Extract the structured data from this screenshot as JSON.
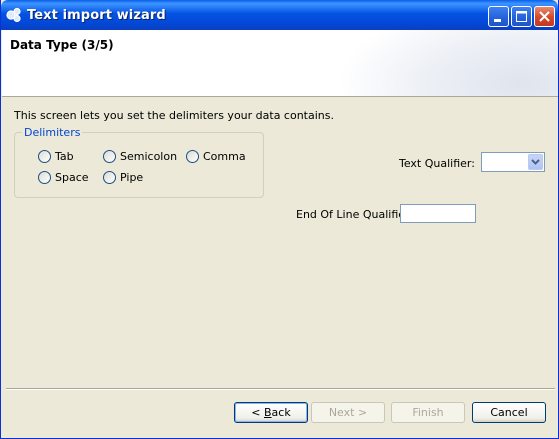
{
  "window": {
    "title": "Text import wizard"
  },
  "header": {
    "title": "Data Type (3/5)"
  },
  "description": "This screen lets you set the delimiters your data contains.",
  "delimiters": {
    "legend": "Delimiters",
    "options": [
      {
        "label": "Tab",
        "checked": false
      },
      {
        "label": "Semicolon",
        "checked": false
      },
      {
        "label": "Comma",
        "checked": false
      },
      {
        "label": "Space",
        "checked": false
      },
      {
        "label": "Pipe",
        "checked": false
      }
    ]
  },
  "text_qualifier": {
    "label": "Text Qualifier:",
    "value": ""
  },
  "end_of_line_qualifier": {
    "label": "End Of Line Qualifier",
    "value": ""
  },
  "buttons": {
    "back_prefix": "< ",
    "back_rest": "Back",
    "back_mnemonic": "B",
    "next": "Next >",
    "finish": "Finish",
    "cancel": "Cancel"
  }
}
